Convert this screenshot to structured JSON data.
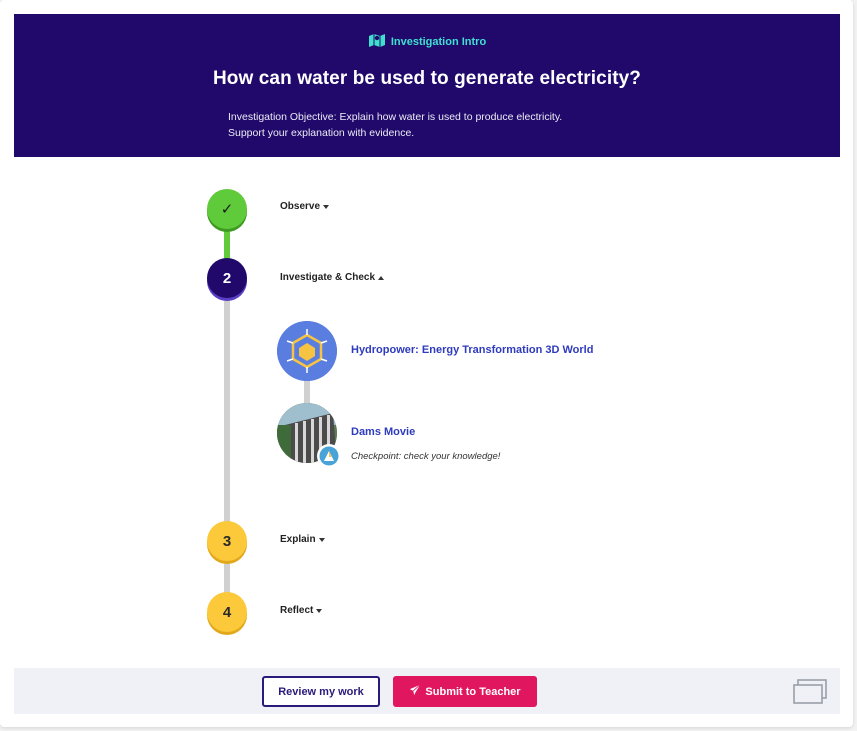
{
  "header": {
    "tag": "Investigation Intro",
    "title": "How can water be used to generate electricity?",
    "objective_line1": "Investigation Objective: Explain how water is used to produce electricity.",
    "objective_line2": "Support your explanation with evidence.",
    "background_color": "#20096b",
    "tag_color": "#3fe0d0"
  },
  "steps": [
    {
      "marker": "✓",
      "label": "Observe",
      "state": "complete",
      "expanded": false,
      "color": "#5fcb3a"
    },
    {
      "marker": "2",
      "label": "Investigate & Check",
      "state": "current",
      "expanded": true,
      "color": "#20096b"
    },
    {
      "marker": "3",
      "label": "Explain",
      "state": "upcoming",
      "expanded": false,
      "color": "#fbc93a"
    },
    {
      "marker": "4",
      "label": "Reflect",
      "state": "upcoming",
      "expanded": false,
      "color": "#fbc93a"
    }
  ],
  "activities": [
    {
      "title": "Hydropower: Energy Transformation 3D World",
      "icon": "3d-world-icon",
      "subtitle": ""
    },
    {
      "title": "Dams Movie",
      "icon": "movie-thumbnail",
      "subtitle": "Checkpoint: check your knowledge!"
    }
  ],
  "footer": {
    "review_label": "Review my work",
    "submit_label": "Submit to Teacher",
    "submit_color": "#e0165e"
  }
}
